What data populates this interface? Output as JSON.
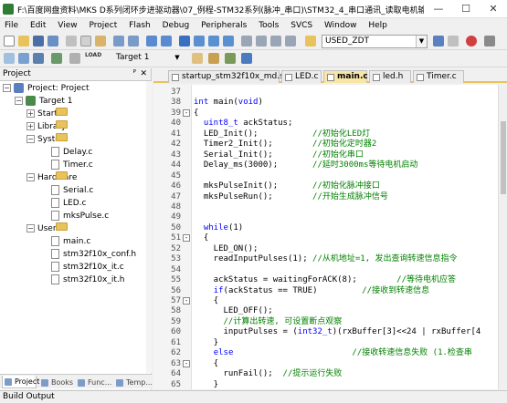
{
  "window": {
    "title": "F:\\百度网盘资料\\MKS D系列闭环步进驱动器\\07_例程-STM32系列(脉冲_串口)\\STM32_4_串口通讯_读取电机输入脉冲...",
    "minimize": "—",
    "maximize": "☐",
    "close": "✕"
  },
  "menu": [
    "File",
    "Edit",
    "View",
    "Project",
    "Flash",
    "Debug",
    "Peripherals",
    "Tools",
    "SVCS",
    "Window",
    "Help"
  ],
  "toolbar": {
    "find_combo_value": "USED_ZDT",
    "target_combo_value": "Target 1",
    "load_label": "LOAD"
  },
  "project_panel": {
    "title": "Project",
    "pin": "ᴾ",
    "close": "✕",
    "tree": {
      "root": "Project: Project",
      "target": "Target 1",
      "groups": [
        {
          "name": "Start",
          "expanded": false,
          "files": []
        },
        {
          "name": "Library",
          "expanded": false,
          "files": []
        },
        {
          "name": "System",
          "expanded": true,
          "files": [
            "Delay.c",
            "Timer.c"
          ]
        },
        {
          "name": "Hardware",
          "expanded": true,
          "files": [
            "Serial.c",
            "LED.c",
            "mksPulse.c"
          ]
        },
        {
          "name": "User",
          "expanded": true,
          "files": [
            "main.c",
            "stm32f10x_conf.h",
            "stm32f10x_it.c",
            "stm32f10x_it.h"
          ]
        }
      ]
    },
    "bottom_tabs": [
      "Project",
      "Books",
      "Func...",
      "Temp..."
    ]
  },
  "editor_tabs": [
    {
      "label": "startup_stm32f10x_md.s",
      "active": false
    },
    {
      "label": "LED.c",
      "active": false
    },
    {
      "label": "main.c",
      "active": true
    },
    {
      "label": "led.h",
      "active": false
    },
    {
      "label": "Timer.c",
      "active": false
    }
  ],
  "code_lines": [
    {
      "n": "37",
      "text": ""
    },
    {
      "n": "38",
      "text": "int main(void)"
    },
    {
      "n": "39",
      "text": "{",
      "fold": "-"
    },
    {
      "n": "40",
      "text": "  uint8_t ackStatus;"
    },
    {
      "n": "41",
      "text": "  LED_Init();           //初始化LED灯"
    },
    {
      "n": "42",
      "text": "  Timer2_Init();        //初始化定时器2"
    },
    {
      "n": "43",
      "text": "  Serial_Init();        //初始化串口"
    },
    {
      "n": "44",
      "text": "  Delay_ms(3000);       //延时3000ms等待电机启动"
    },
    {
      "n": "45",
      "text": ""
    },
    {
      "n": "46",
      "text": "  mksPulseInit();       //初始化脉冲接口"
    },
    {
      "n": "47",
      "text": "  mksPulseRun();        //开始生成脉冲信号"
    },
    {
      "n": "48",
      "text": ""
    },
    {
      "n": "49",
      "text": ""
    },
    {
      "n": "50",
      "text": "  while(1)"
    },
    {
      "n": "51",
      "text": "  {",
      "fold": "-"
    },
    {
      "n": "52",
      "text": "    LED_ON();"
    },
    {
      "n": "53",
      "text": "    readInputPulses(1); //从机地址=1, 发出查询转速信息指令"
    },
    {
      "n": "54",
      "text": ""
    },
    {
      "n": "55",
      "text": "    ackStatus = waitingForACK(8);        //等待电机应答"
    },
    {
      "n": "56",
      "text": "    if(ackStatus == TRUE)         //接收到转速信息"
    },
    {
      "n": "57",
      "text": "    {",
      "fold": "-"
    },
    {
      "n": "58",
      "text": "      LED_OFF();"
    },
    {
      "n": "59",
      "text": "      //计算出转速, 可设置断点观察"
    },
    {
      "n": "60",
      "text": "      inputPulses = (int32_t)(rxBuffer[3]<<24 | rxBuffer[4"
    },
    {
      "n": "61",
      "text": "    }"
    },
    {
      "n": "62",
      "text": "    else                        //接收转速信息失败 (1.检查串"
    },
    {
      "n": "63",
      "text": "    {",
      "fold": "-"
    },
    {
      "n": "64",
      "text": "      runFail();  //提示运行失败"
    },
    {
      "n": "65",
      "text": "    }"
    }
  ],
  "build_output": {
    "title": "Build Output"
  }
}
